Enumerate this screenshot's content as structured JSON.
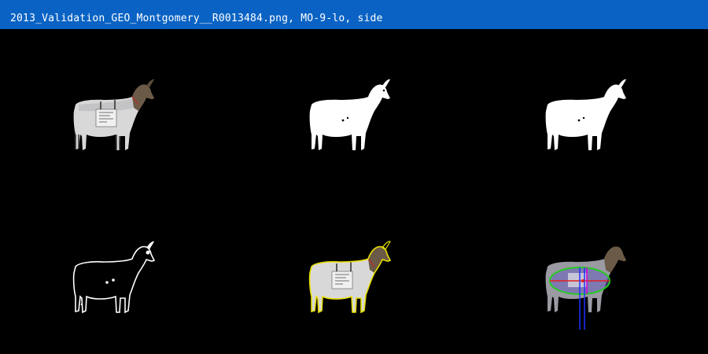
{
  "window": {
    "title": "2013_Validation_GEO_Montgomery__R0013484.png, MO-9-lo, side"
  },
  "colors": {
    "titlebar": "#0a63c4",
    "background": "#000000",
    "goat_body": "#dcdcdc",
    "goat_head": "#6a5a48",
    "mask": "#ffffff",
    "contour_yellow": "#e8e000",
    "ellipse_green": "#22cc22",
    "axis_red": "#e02020",
    "axis_blue": "#2030ff",
    "axis_magenta": "#d000d0"
  },
  "panels": [
    {
      "id": "original",
      "icon": "goat-photo"
    },
    {
      "id": "binary-mask",
      "icon": "goat-silhouette"
    },
    {
      "id": "filled-mask",
      "icon": "goat-silhouette"
    },
    {
      "id": "edge-contour",
      "icon": "goat-outline"
    },
    {
      "id": "contour-overlay",
      "icon": "goat-photo-yellow-outline"
    },
    {
      "id": "measurement-overlay",
      "icon": "goat-ellipse-axes"
    }
  ]
}
